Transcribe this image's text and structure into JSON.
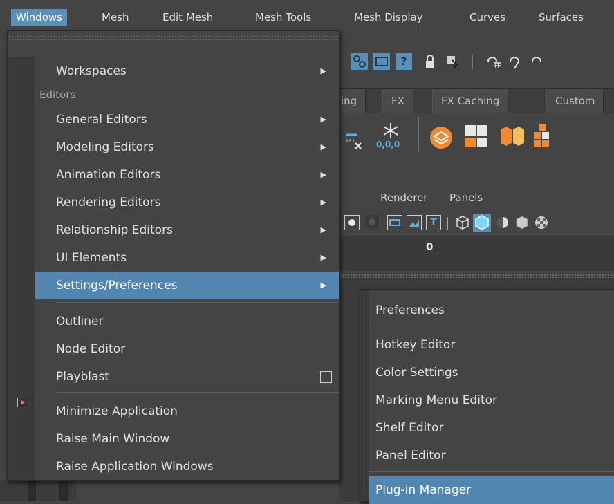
{
  "menubar": {
    "items": [
      {
        "label": "Windows",
        "active": true
      },
      {
        "label": "Mesh"
      },
      {
        "label": "Edit Mesh"
      },
      {
        "label": "Mesh Tools"
      },
      {
        "label": "Mesh Display"
      },
      {
        "label": "Curves"
      },
      {
        "label": "Surfaces"
      }
    ]
  },
  "background": {
    "shelf_tabs": [
      "ing",
      "FX",
      "FX Caching",
      "Custom"
    ],
    "panel_menus": [
      "Renderer",
      "Panels"
    ],
    "shelf_value": "0,0,0",
    "value_field": "0",
    "colors": {
      "accent": "#5285b0",
      "bg": "#444444",
      "gutter": "#3a3a3a"
    }
  },
  "windows_menu": {
    "items": [
      {
        "label": "Workspaces",
        "submenu": true
      },
      {
        "section": "Editors"
      },
      {
        "label": "General Editors",
        "submenu": true
      },
      {
        "label": "Modeling Editors",
        "submenu": true
      },
      {
        "label": "Animation Editors",
        "submenu": true
      },
      {
        "label": "Rendering Editors",
        "submenu": true
      },
      {
        "label": "Relationship Editors",
        "submenu": true
      },
      {
        "label": "UI Elements",
        "submenu": true
      },
      {
        "label": "Settings/Preferences",
        "submenu": true,
        "highlighted": true
      },
      {
        "label": "Outliner"
      },
      {
        "label": "Node Editor"
      },
      {
        "label": "Playblast",
        "option_box": true,
        "icon": "playblast-icon"
      },
      {
        "label": "Minimize Application"
      },
      {
        "label": "Raise Main Window"
      },
      {
        "label": "Raise Application Windows"
      }
    ]
  },
  "settings_submenu": {
    "items": [
      {
        "label": "Preferences"
      },
      {
        "label": "Hotkey Editor"
      },
      {
        "label": "Color Settings"
      },
      {
        "label": "Marking Menu Editor"
      },
      {
        "label": "Shelf Editor"
      },
      {
        "label": "Panel Editor"
      },
      {
        "label": "Plug-in Manager",
        "highlighted": true
      }
    ]
  }
}
